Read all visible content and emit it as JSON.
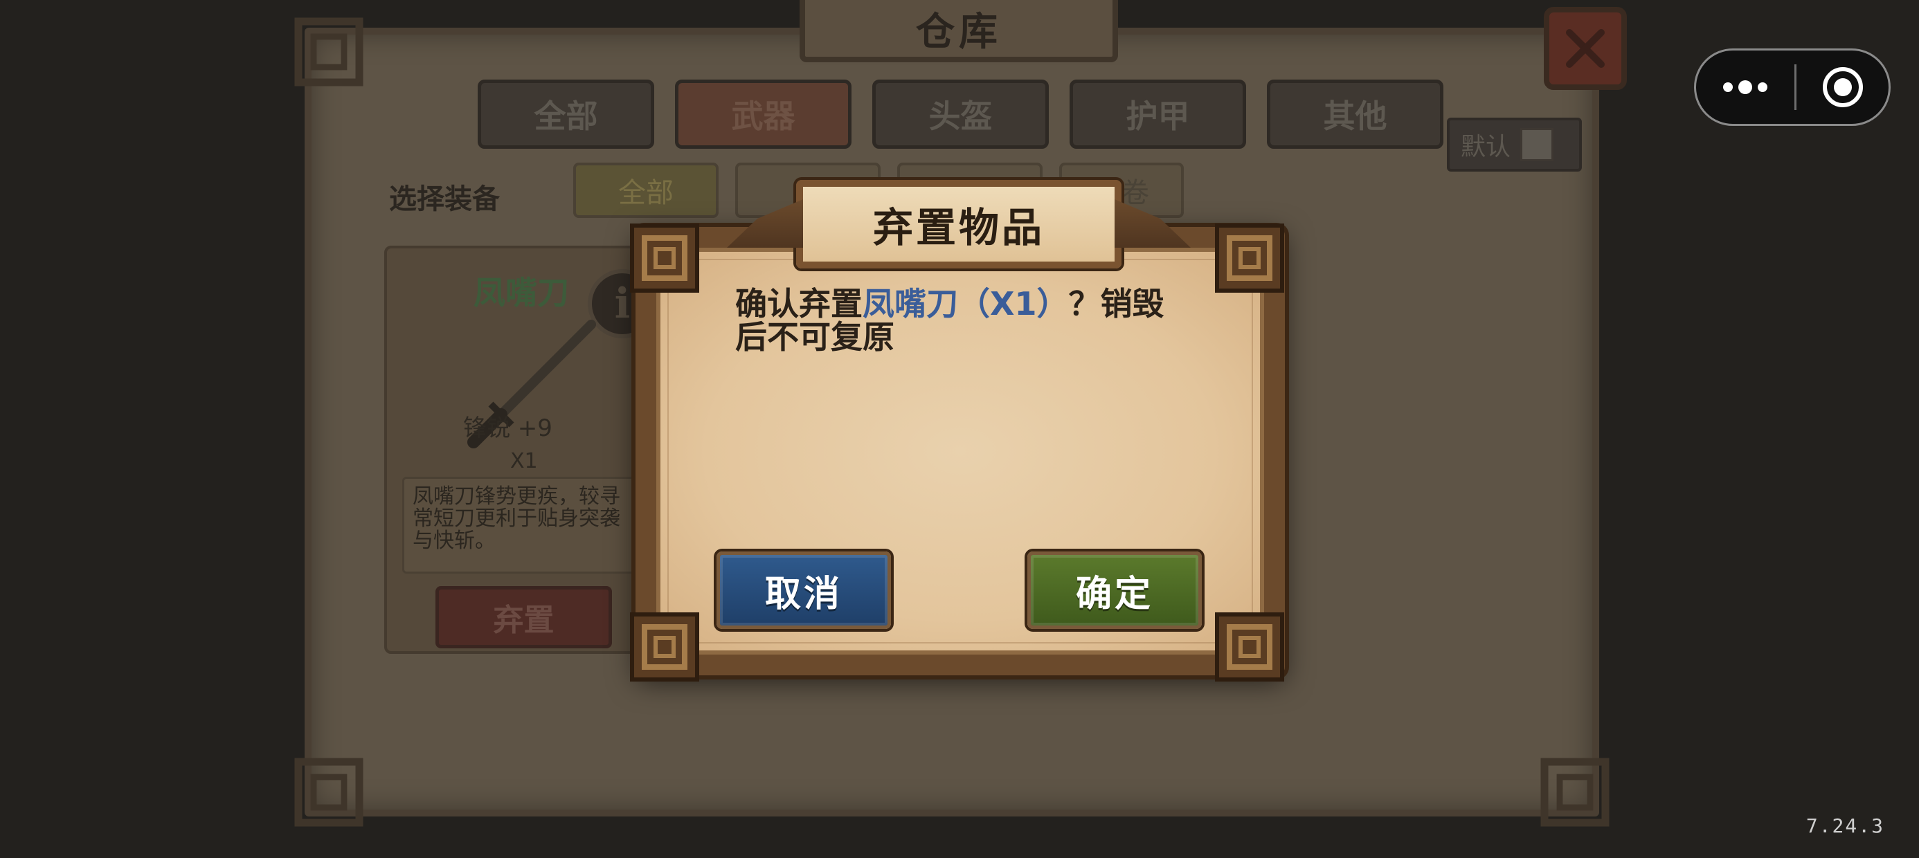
{
  "warehouse": {
    "title": "仓库",
    "tabs": [
      {
        "label": "全部",
        "active": false
      },
      {
        "label": "武器",
        "active": true
      },
      {
        "label": "头盔",
        "active": false
      },
      {
        "label": "护甲",
        "active": false
      },
      {
        "label": "其他",
        "active": false
      }
    ],
    "default_label": "默认",
    "select_label": "选择装备",
    "subtabs": [
      {
        "label": "全部",
        "active": true
      },
      {
        "label": "",
        "active": false
      },
      {
        "label": "",
        "active": false
      },
      {
        "label": "法卷",
        "active": false
      }
    ],
    "item": {
      "name": "凤嘴刀",
      "stat": "锋锐  +9",
      "count": "X1",
      "description": "凤嘴刀锋势更疾，较寻常短刀更利于贴身突袭与快斩。",
      "discard_label": "弃置"
    }
  },
  "dialog": {
    "title": "弃置物品",
    "message_prefix": "确认弃置",
    "item_name": "凤嘴刀",
    "item_qty": "（X1）",
    "message_suffix": "？销毁后不可复原",
    "cancel_label": "取消",
    "confirm_label": "确定"
  },
  "version": "7.24.3",
  "colors": {
    "cancel": "#2f5a8d",
    "confirm": "#5b7a2c",
    "item_highlight": "#3a5d99",
    "overlay": "#1f1d1b"
  }
}
